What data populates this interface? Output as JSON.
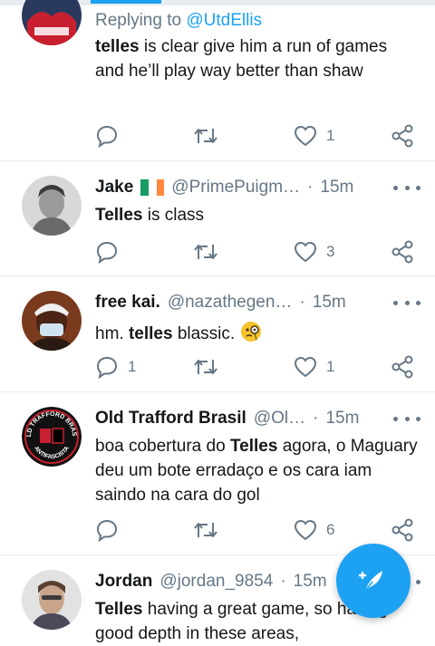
{
  "colors": {
    "accent": "#1da1f2",
    "secondary_text": "#657786",
    "divider": "#e6ecf0"
  },
  "tweets": [
    {
      "replying_prefix": "Replying to ",
      "replying_handle": "@UtdEllis",
      "text_bold": "telles",
      "text_rest": " is clear give him a run of games and he’ll play way better than shaw",
      "reply_count": "",
      "retweet_count": "",
      "like_count": "1"
    },
    {
      "name": "Jake",
      "handle": "@PrimePuigm…",
      "separator": "·",
      "time": "15m",
      "text_bold": "Telles",
      "text_rest": " is class",
      "reply_count": "",
      "retweet_count": "",
      "like_count": "3"
    },
    {
      "name": "free kai.",
      "handle": "@nazathegen…",
      "separator": "·",
      "time": "15m",
      "text_before": "hm. ",
      "text_bold": "telles",
      "text_rest": " blassic. ",
      "emoji_icon": "face-with-monocle-icon",
      "reply_count": "1",
      "retweet_count": "",
      "like_count": "1"
    },
    {
      "name": "Old Trafford Brasil",
      "handle": "@Ol…",
      "separator": "·",
      "time": "15m",
      "avatar_text_top": "OLD TRAFFORD BRASIL",
      "avatar_text_bottom": "ANTIFASCISTA",
      "text_before": "boa cobertura do ",
      "text_bold": "Telles",
      "text_rest": " agora, o Maguary deu um bote erradaço e os cara iam saindo na cara do gol",
      "reply_count": "",
      "retweet_count": "",
      "like_count": "6"
    },
    {
      "name": "Jordan",
      "handle": "@jordan_9854",
      "separator": "·",
      "time": "15m",
      "text_bold": "Telles",
      "text_rest": " having a great game, so having good depth in these areas,"
    }
  ],
  "fab": {
    "icon": "compose-feather-icon"
  }
}
